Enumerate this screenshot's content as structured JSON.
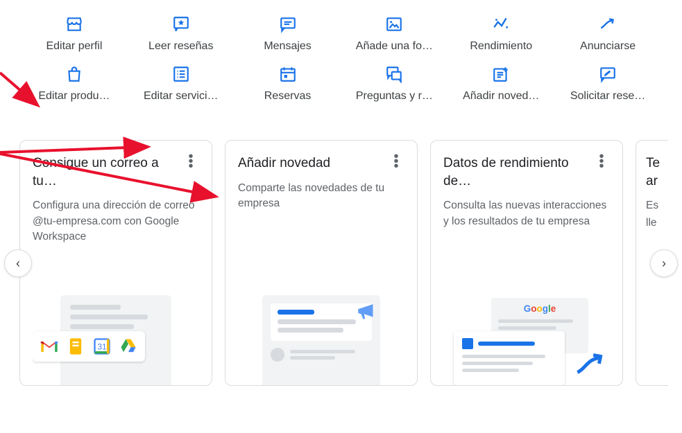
{
  "colors": {
    "accent": "#1a73e8",
    "text": "#3c4043",
    "muted": "#5f6368",
    "border": "#dadce0"
  },
  "actions": {
    "row1": [
      {
        "name": "edit-profile",
        "label": "Editar perfil",
        "icon": "storefront"
      },
      {
        "name": "read-reviews",
        "label": "Leer reseñas",
        "icon": "star-chat"
      },
      {
        "name": "messages",
        "label": "Mensajes",
        "icon": "message"
      },
      {
        "name": "add-photo",
        "label": "Añade una fo…",
        "icon": "photo"
      },
      {
        "name": "performance",
        "label": "Rendimiento",
        "icon": "spark"
      },
      {
        "name": "advertise",
        "label": "Anunciarse",
        "icon": "trend"
      }
    ],
    "row2": [
      {
        "name": "edit-products",
        "label": "Editar produ…",
        "icon": "bag"
      },
      {
        "name": "edit-services",
        "label": "Editar servici…",
        "icon": "list-box"
      },
      {
        "name": "bookings",
        "label": "Reservas",
        "icon": "calendar"
      },
      {
        "name": "q-and-a",
        "label": "Preguntas y r…",
        "icon": "qa"
      },
      {
        "name": "add-update",
        "label": "Añadir noved…",
        "icon": "post-add"
      },
      {
        "name": "request-reviews",
        "label": "Solicitar rese…",
        "icon": "review-request"
      }
    ]
  },
  "cards": [
    {
      "name": "card-workspace-email",
      "title": "Consigue un correo a tu…",
      "desc": "Configura una dirección de correo @tu-empresa.com con Google Workspace",
      "illust": "workspace"
    },
    {
      "name": "card-add-update",
      "title": "Añadir novedad",
      "desc": "Comparte las novedades de tu empresa",
      "illust": "megaphone"
    },
    {
      "name": "card-performance",
      "title": "Datos de rendimiento de…",
      "desc": "Consulta las nuevas interacciones y los resultados de tu empresa",
      "illust": "performance"
    },
    {
      "name": "card-partial",
      "title": "Te",
      "title2": "ar",
      "desc": "Es",
      "desc2": "lle",
      "illust": "none"
    }
  ],
  "nav": {
    "prev": "‹",
    "next": "›"
  },
  "googleLogo": [
    "G",
    "o",
    "o",
    "g",
    "l",
    "e"
  ]
}
